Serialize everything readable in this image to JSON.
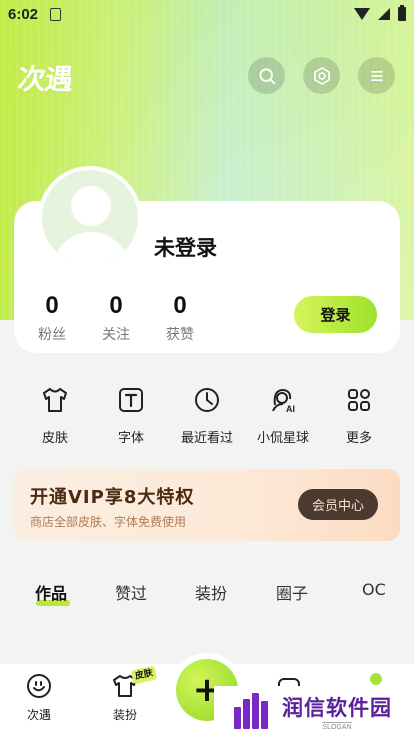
{
  "status_bar": {
    "time": "6:02"
  },
  "header": {
    "logo_text": "次遇",
    "icons": [
      "search-icon",
      "settings-icon",
      "menu-icon"
    ]
  },
  "profile": {
    "username": "未登录",
    "stats": [
      {
        "value": "0",
        "label": "粉丝"
      },
      {
        "value": "0",
        "label": "关注"
      },
      {
        "value": "0",
        "label": "获赞"
      }
    ],
    "login_label": "登录"
  },
  "quick_actions": [
    {
      "label": "皮肤",
      "icon": "tshirt-icon"
    },
    {
      "label": "字体",
      "icon": "font-icon"
    },
    {
      "label": "最近看过",
      "icon": "clock-icon"
    },
    {
      "label": "小侃星球",
      "icon": "ai-avatar-icon"
    },
    {
      "label": "更多",
      "icon": "grid-icon"
    }
  ],
  "vip": {
    "title": "开通VIP享8大特权",
    "subtitle": "商店全部皮肤、字体免费使用",
    "button_label": "会员中心"
  },
  "tabs": [
    {
      "label": "作品",
      "active": true
    },
    {
      "label": "赞过",
      "active": false
    },
    {
      "label": "装扮",
      "active": false
    },
    {
      "label": "圈子",
      "active": false
    },
    {
      "label": "OC",
      "active": false
    }
  ],
  "bottom_nav": {
    "items": [
      {
        "label": "次遇",
        "icon": "smile-icon"
      },
      {
        "label": "装扮",
        "icon": "tshirt-icon"
      }
    ],
    "fab_icon": "plus-icon",
    "fab_symbol": "+",
    "skin_badge": "皮肤"
  },
  "watermark": {
    "text": "润信软件园",
    "sub": "SLOGAN"
  },
  "colors": {
    "accent_green": "#a8e23a",
    "vip_text": "#4a2a12",
    "vip_button_bg": "#4a3a30"
  }
}
